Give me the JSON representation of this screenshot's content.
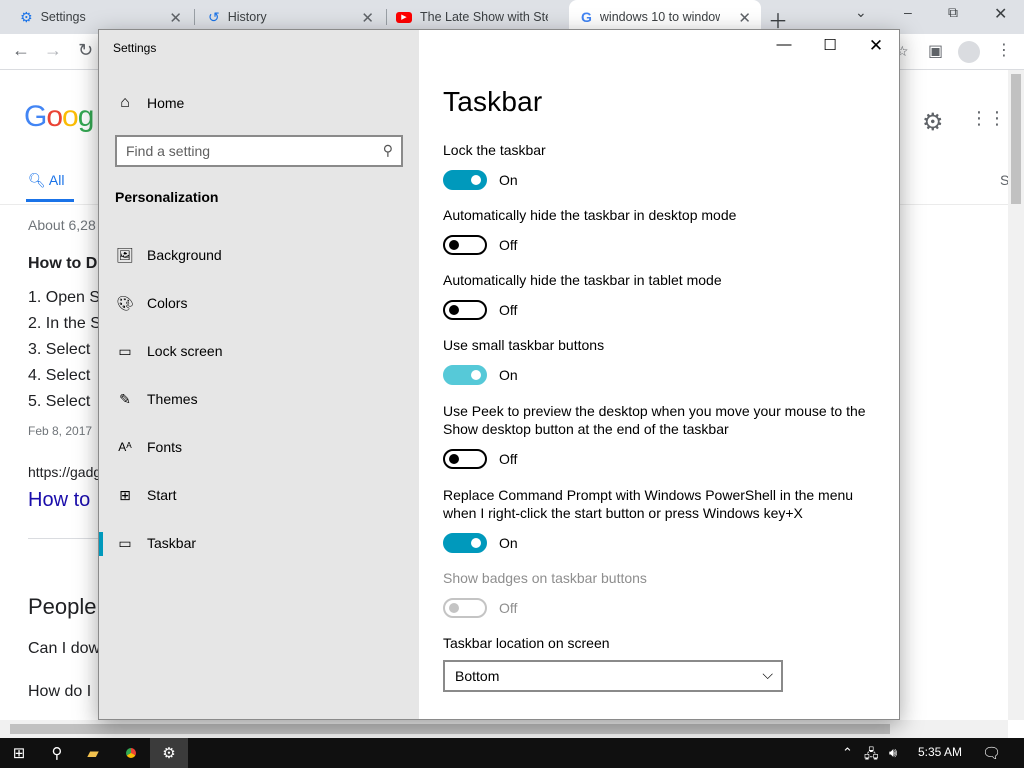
{
  "browser": {
    "tabs": [
      {
        "title": "Settings",
        "icon": "gear-icon"
      },
      {
        "title": "History",
        "icon": "history-icon"
      },
      {
        "title": "The Late Show with Ste",
        "icon": "youtube-icon"
      },
      {
        "title": "windows 10 to window",
        "icon": "google-icon"
      }
    ],
    "colors": {
      "tab_strip": "#dee1e6",
      "youtube_red": "#ff0000",
      "link_blue": "#1a0dab"
    }
  },
  "google_page": {
    "logo": "Goog",
    "tab_all": "All",
    "right_letter": "S",
    "result_count": "About 6,28",
    "heading": "How to Do",
    "steps": [
      "1. Open S",
      "2. In the S",
      "3. Select",
      "4. Select",
      "5. Select"
    ],
    "date": "Feb 8, 2017",
    "url": "https://gadg",
    "link": "How to",
    "people_heading": "People",
    "questions": [
      "Can I dow",
      "How do I"
    ]
  },
  "settings": {
    "window_title": "Settings",
    "home_label": "Home",
    "search_placeholder": "Find a setting",
    "section_header": "Personalization",
    "nav_items": [
      {
        "label": "Background",
        "icon": "image-icon"
      },
      {
        "label": "Colors",
        "icon": "palette-icon"
      },
      {
        "label": "Lock screen",
        "icon": "lock-screen-icon"
      },
      {
        "label": "Themes",
        "icon": "themes-icon"
      },
      {
        "label": "Fonts",
        "icon": "fonts-icon"
      },
      {
        "label": "Start",
        "icon": "start-icon"
      },
      {
        "label": "Taskbar",
        "icon": "taskbar-icon"
      }
    ],
    "active_nav": "Taskbar",
    "page_title": "Taskbar",
    "options": [
      {
        "label": "Lock the taskbar",
        "state": "On"
      },
      {
        "label": "Automatically hide the taskbar in desktop mode",
        "state": "Off"
      },
      {
        "label": "Automatically hide the taskbar in tablet mode",
        "state": "Off"
      },
      {
        "label": "Use small taskbar buttons",
        "state": "On"
      },
      {
        "label": "Use Peek to preview the desktop when you move your mouse to the Show desktop button at the end of the taskbar",
        "state": "Off"
      },
      {
        "label": "Replace Command Prompt with Windows PowerShell in the menu when I right-click the start button or press Windows key+X",
        "state": "On"
      },
      {
        "label": "Show badges on taskbar buttons",
        "state": "Off",
        "disabled": true
      }
    ],
    "location_label": "Taskbar location on screen",
    "location_value": "Bottom",
    "colors": {
      "accent": "#0099bc",
      "accent_hover": "#56c9d8",
      "sidebar": "#e6e6e6"
    }
  },
  "taskbar": {
    "clock": "5:35 AM",
    "items": [
      "windows-start-icon",
      "search-icon",
      "file-explorer-icon",
      "chrome-icon",
      "settings-icon"
    ],
    "tray": [
      "chevron-up-icon",
      "network-icon",
      "volume-icon",
      "notification-icon"
    ]
  }
}
